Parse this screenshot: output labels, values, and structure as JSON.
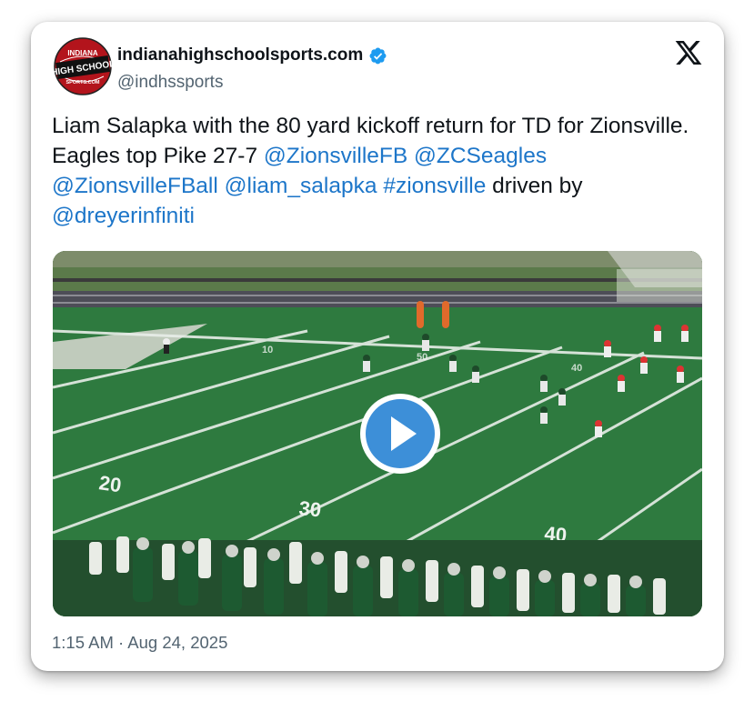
{
  "author": {
    "avatar_text": [
      "INDIANA",
      "HIGH SCHOOL",
      "SPORTS.COM"
    ],
    "display_name": "indianahighschoolsports.com",
    "handle": "@indhssports",
    "verified": true
  },
  "post": {
    "text_segments": [
      {
        "text": "Liam Salapka with the 80 yard kickoff return for TD for Zionsville. Eagles top Pike 27-7 ",
        "link": false
      },
      {
        "text": "@ZionsvilleFB",
        "link": true
      },
      {
        "text": " ",
        "link": false
      },
      {
        "text": "@ZCSeagles",
        "link": true
      },
      {
        "text": " ",
        "link": false
      },
      {
        "text": "@ZionsvilleFBall",
        "link": true
      },
      {
        "text": " ",
        "link": false
      },
      {
        "text": "@liam_salapka",
        "link": true
      },
      {
        "text": " ",
        "link": false
      },
      {
        "text": "#zionsville",
        "link": true
      },
      {
        "text": " driven by ",
        "link": false
      },
      {
        "text": "@dreyerinfiniti",
        "link": true
      }
    ],
    "timestamp": "1:15 AM · Aug 24, 2025"
  },
  "media": {
    "type": "video",
    "yard_numbers": [
      "10",
      "20",
      "30",
      "40",
      "50",
      "40",
      "20"
    ]
  },
  "icons": {
    "platform_logo": "x-logo-icon",
    "verified": "verified-badge-icon",
    "play": "play-icon"
  },
  "colors": {
    "link": "#1d76c9",
    "verified": "#1d9bf0",
    "play_button": "#3d8fd8",
    "field": "#2c6a3d",
    "avatar_red": "#b3141c"
  }
}
